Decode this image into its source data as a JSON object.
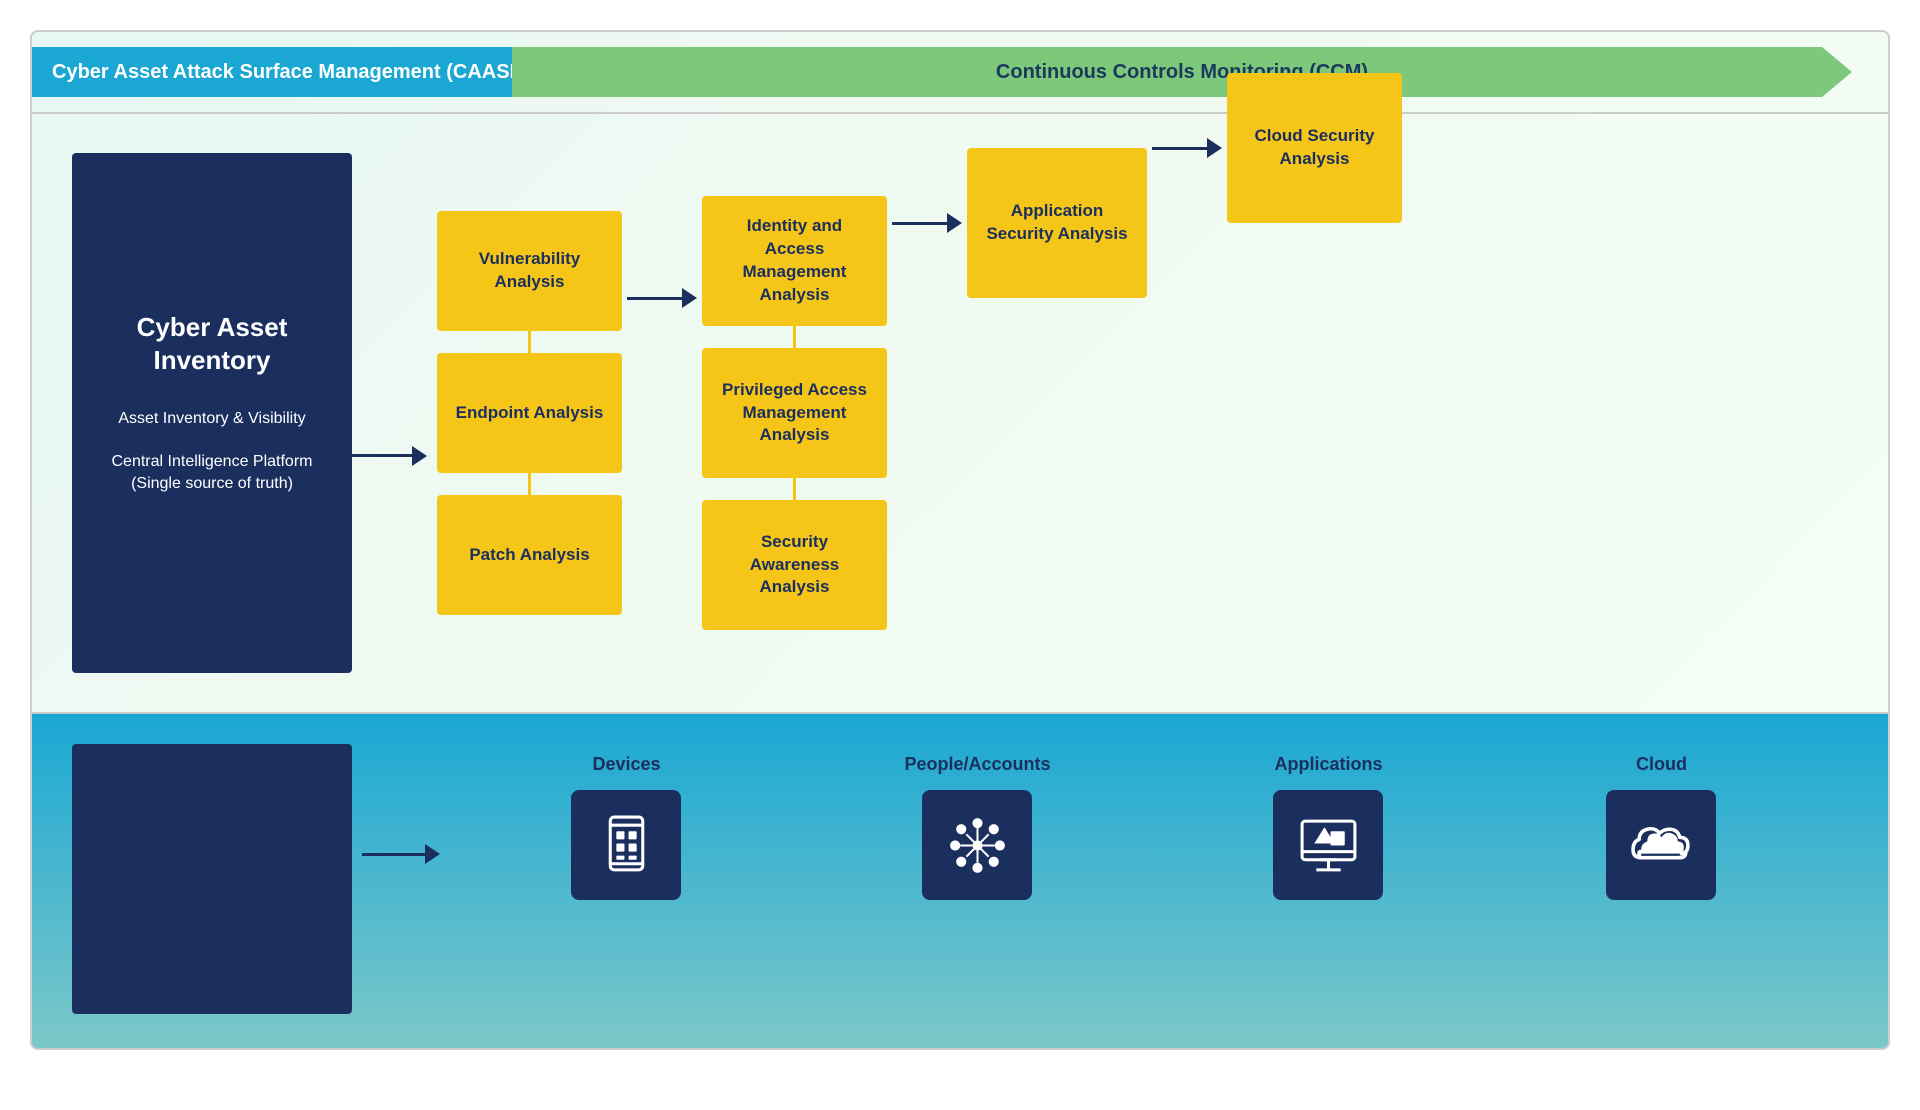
{
  "banner": {
    "caasm_label": "Cyber Asset Attack Surface Management (CAASM)",
    "ccm_label": "Continuous Controls Monitoring (CCM)"
  },
  "inventory": {
    "title": "Cyber Asset Inventory",
    "sub1": "Asset Inventory & Visibility",
    "sub2": "Central Intelligence Platform (Single source of truth)"
  },
  "analyses": {
    "col1": [
      {
        "label": "Vulnerability Analysis"
      },
      {
        "label": "Endpoint Analysis"
      },
      {
        "label": "Patch Analysis"
      }
    ],
    "col2": [
      {
        "label": "Identity and Access Management Analysis"
      },
      {
        "label": "Privileged Access Management Analysis"
      },
      {
        "label": "Security Awareness Analysis"
      }
    ],
    "col3": [
      {
        "label": "Application Security Analysis"
      }
    ],
    "col4": [
      {
        "label": "Cloud Security Analysis"
      }
    ]
  },
  "bottom": {
    "devices_label": "Devices",
    "people_label": "People/Accounts",
    "apps_label": "Applications",
    "cloud_label": "Cloud"
  }
}
